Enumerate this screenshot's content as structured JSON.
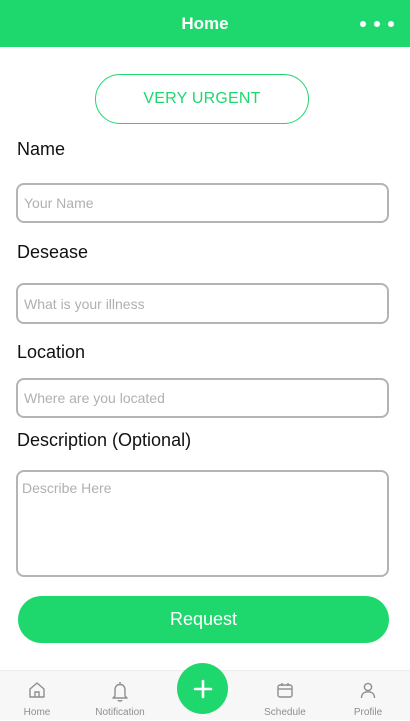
{
  "header": {
    "title": "Home",
    "menu_icon": "more-horizontal-icon"
  },
  "urgency": {
    "label": "VERY URGENT"
  },
  "form": {
    "name": {
      "label": "Name",
      "placeholder": "Your Name",
      "value": ""
    },
    "disease": {
      "label": "Desease",
      "placeholder": "What is your illness",
      "value": ""
    },
    "location": {
      "label": "Location",
      "placeholder": "Where are you located",
      "value": ""
    },
    "description": {
      "label": "Description (Optional)",
      "placeholder": "Describe Here",
      "value": ""
    },
    "submit_label": "Request"
  },
  "tabbar": {
    "items": [
      {
        "label": "Home",
        "icon": "home-icon"
      },
      {
        "label": "Notification",
        "icon": "bell-icon"
      },
      {
        "label": "",
        "icon": "plus-icon"
      },
      {
        "label": "Schedule",
        "icon": "calendar-icon"
      },
      {
        "label": "Profile",
        "icon": "user-icon"
      }
    ]
  },
  "colors": {
    "accent": "#1ed86e",
    "input_border": "#b4b4b4",
    "placeholder": "#b0b0b0",
    "tab_inactive": "#8e8e8e"
  }
}
